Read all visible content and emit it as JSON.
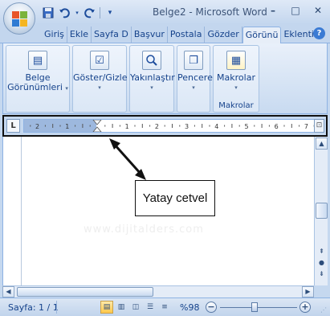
{
  "window": {
    "title": "Belge2 - Microsoft Word",
    "controls": {
      "minimize": "–",
      "maximize": "□",
      "close": "✕"
    }
  },
  "quick_access": {
    "save_icon": "save-icon",
    "undo_icon": "undo-icon",
    "redo_icon": "redo-icon",
    "customize_icon": "customize-qat-icon"
  },
  "tabs": [
    {
      "label": "Giriş",
      "active": false
    },
    {
      "label": "Ekle",
      "active": false
    },
    {
      "label": "Sayfa D",
      "active": false
    },
    {
      "label": "Başvur",
      "active": false
    },
    {
      "label": "Postala",
      "active": false
    },
    {
      "label": "Gözder",
      "active": false
    },
    {
      "label": "Görünü",
      "active": true
    },
    {
      "label": "Eklenti",
      "active": false
    }
  ],
  "ribbon": {
    "buttons": [
      {
        "line1": "Belge",
        "line2": "Görünümleri"
      },
      {
        "line1": "Göster/Gizle",
        "line2": ""
      },
      {
        "line1": "Yakınlaştır",
        "line2": ""
      },
      {
        "line1": "Pencere",
        "line2": ""
      },
      {
        "line1": "Makrolar",
        "line2": ""
      }
    ],
    "group_label_macros": "Makrolar"
  },
  "ruler": {
    "tab_selector": "L",
    "numbers_left": [
      "2",
      "1"
    ],
    "numbers_right": [
      "1",
      "2",
      "3",
      "4",
      "5",
      "6",
      "7"
    ]
  },
  "callout": {
    "text": "Yatay cetvel"
  },
  "watermark": "www.dijitalders.com",
  "status": {
    "page": "Sayfa: 1 / 1",
    "zoom": "%98",
    "zoom_level_percent": 98
  },
  "colors": {
    "accent": "#15428b",
    "ribbon_bg": "#d5e3f4",
    "active_view": "#ffc84a"
  }
}
